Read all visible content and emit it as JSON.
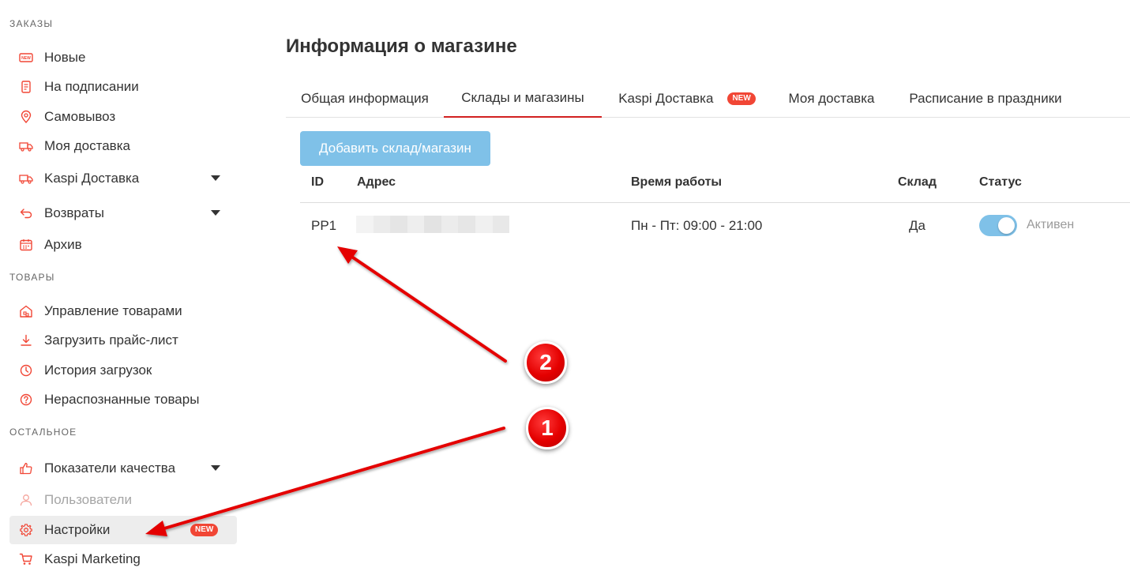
{
  "colors": {
    "accent": "#f14635",
    "tab_underline": "#d22020",
    "primary_button": "#7fc1e8",
    "toggle_on": "#7fc1e8",
    "annotation_red": "#e40000"
  },
  "sidebar": {
    "sections": [
      {
        "title": "ЗАКАЗЫ"
      },
      {
        "title": "ТОВАРЫ"
      },
      {
        "title": "ОСТАЛЬНОЕ"
      }
    ],
    "orders": [
      {
        "label": "Новые",
        "icon": "new-icon"
      },
      {
        "label": "На подписании",
        "icon": "document-icon"
      },
      {
        "label": "Самовывоз",
        "icon": "location-pin-icon"
      },
      {
        "label": "Моя доставка",
        "icon": "truck-icon"
      },
      {
        "label": "Kaspi Доставка",
        "icon": "truck-icon",
        "has_submenu": true
      },
      {
        "label": "Возвраты",
        "icon": "return-arrow-icon",
        "has_submenu": true
      },
      {
        "label": "Архив",
        "icon": "calendar-icon"
      }
    ],
    "products": [
      {
        "label": "Управление товарами",
        "icon": "warehouse-icon"
      },
      {
        "label": "Загрузить прайс-лист",
        "icon": "download-icon"
      },
      {
        "label": "История загрузок",
        "icon": "clock-icon"
      },
      {
        "label": "Нераспознанные товары",
        "icon": "question-icon"
      }
    ],
    "other": [
      {
        "label": "Показатели качества",
        "icon": "thumbs-up-icon",
        "has_submenu": true
      },
      {
        "label": "Пользователи",
        "icon": "user-icon",
        "disabled": true
      },
      {
        "label": "Настройки",
        "icon": "gear-icon",
        "active": true,
        "badge": "NEW"
      },
      {
        "label": "Kaspi Marketing",
        "icon": "cart-icon"
      }
    ]
  },
  "main": {
    "title": "Информация о магазине",
    "tabs": [
      {
        "label": "Общая информация"
      },
      {
        "label": "Склады и магазины",
        "active": true
      },
      {
        "label": "Kaspi Доставка",
        "badge": "NEW"
      },
      {
        "label": "Моя доставка"
      },
      {
        "label": "Расписание в праздники"
      }
    ],
    "add_button_label": "Добавить склад/магазин",
    "table": {
      "headers": {
        "id": "ID",
        "address": "Адрес",
        "hours": "Время работы",
        "warehouse": "Склад",
        "status": "Статус"
      },
      "rows": [
        {
          "id": "PP1",
          "hours": "Пн - Пт: 09:00 - 21:00",
          "warehouse": "Да",
          "status": "Активен",
          "active": true
        }
      ]
    }
  },
  "annotations": [
    {
      "label": "1"
    },
    {
      "label": "2"
    }
  ]
}
